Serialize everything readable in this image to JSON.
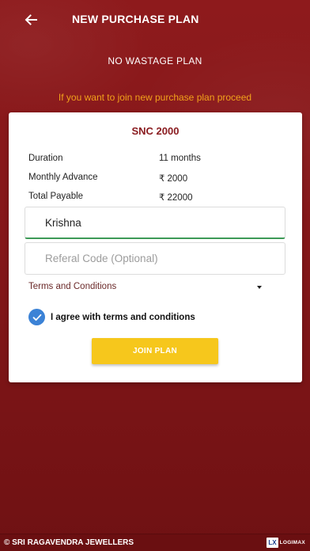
{
  "header": {
    "title": "NEW PURCHASE PLAN"
  },
  "plan": {
    "type": "NO WASTAGE PLAN",
    "prompt": "If you want to join new purchase plan proceed",
    "code": "SNC 2000"
  },
  "details": [
    {
      "label": "Duration",
      "value": "11 months"
    },
    {
      "label": "Monthly Advance",
      "value": "₹ 2000"
    },
    {
      "label": "Total Payable",
      "value": "₹ 22000"
    }
  ],
  "form": {
    "name_value": "Krishna",
    "referal_placeholder": "Referal Code (Optional)",
    "terms_label": "Terms and Conditions",
    "agree_label": "I agree with terms and conditions",
    "agree_checked": true,
    "join_label": "JOIN PLAN"
  },
  "footer": {
    "copyright": "© SRI RAGAVENDRA JEWELLERS",
    "logo_mark": "LX",
    "logo_text": "LOGIMAX"
  },
  "colors": {
    "background": "#841719",
    "accent_text": "#f2a21b",
    "button": "#f6c71c",
    "checkbox": "#3b82d6",
    "plan_code": "#8a1c20"
  },
  "icons": {
    "back": "arrow-left-icon",
    "check": "check-icon",
    "dropdown": "caret-down-icon"
  }
}
